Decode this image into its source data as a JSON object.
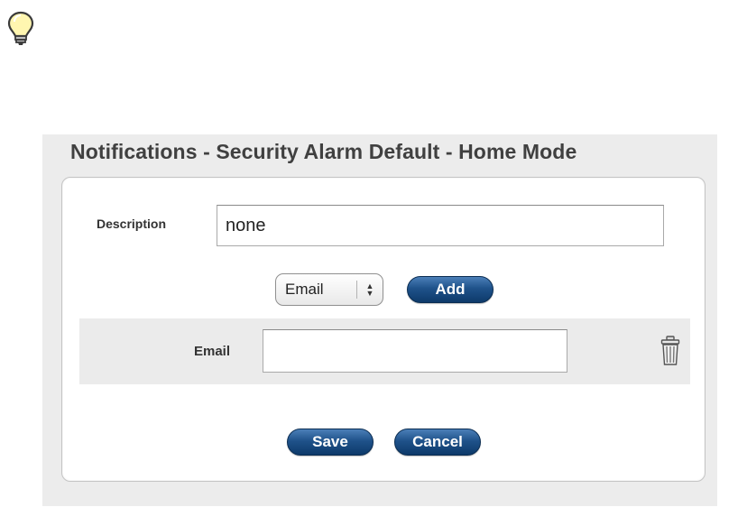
{
  "icons": {
    "hint": "lightbulb-icon",
    "delete": "trash-icon"
  },
  "panel": {
    "title": "Notifications - Security Alarm Default - Home Mode"
  },
  "form": {
    "description_label": "Description",
    "description_value": "none",
    "type_select_value": "Email",
    "add_label": "Add",
    "email_label": "Email",
    "email_value": "",
    "save_label": "Save",
    "cancel_label": "Cancel"
  },
  "colors": {
    "button_blue": "#1f528a",
    "title_gray": "#404040",
    "bulb_yellow": "#f5c400"
  }
}
